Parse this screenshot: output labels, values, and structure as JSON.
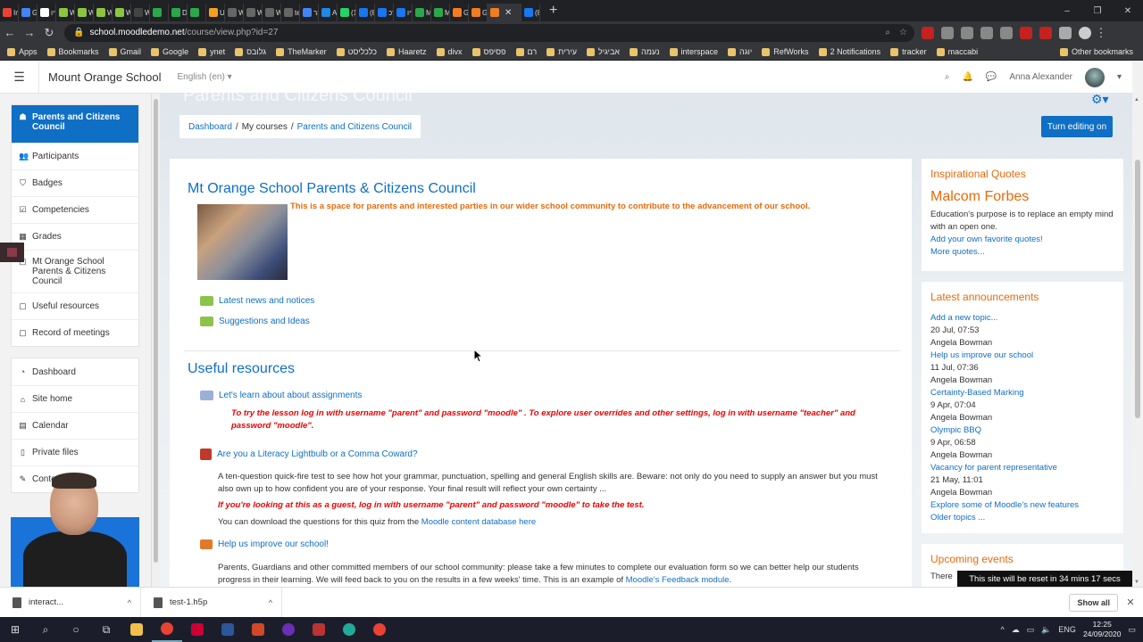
{
  "browser": {
    "tabs": [
      {
        "label": "Inb",
        "color": "#ea4335"
      },
      {
        "label": "Go",
        "color": "#4285f4"
      },
      {
        "label": "דיו",
        "color": "#ffffff"
      },
      {
        "label": "Wh",
        "color": "#8cc63f"
      },
      {
        "label": "Wh",
        "color": "#8cc63f"
      },
      {
        "label": "Wh",
        "color": "#8cc63f"
      },
      {
        "label": "Wh",
        "color": "#8cc63f"
      },
      {
        "label": "We",
        "color": "#444444"
      },
      {
        "label": "",
        "color": "#2aa84a"
      },
      {
        "label": "De",
        "color": "#2aa84a"
      },
      {
        "label": "",
        "color": "#2aa84a"
      },
      {
        "label": "Ult",
        "color": "#f4a020"
      },
      {
        "label": "Wh",
        "color": "#666666"
      },
      {
        "label": "Wh",
        "color": "#666666"
      },
      {
        "label": "Wh",
        "color": "#666666"
      },
      {
        "label": "tes",
        "color": "#666666"
      },
      {
        "label": "קר",
        "color": "#4285f4"
      },
      {
        "label": "All",
        "color": "#1e88e5"
      },
      {
        "label": "(1",
        "color": "#25d366"
      },
      {
        "label": "(8",
        "color": "#1877f2"
      },
      {
        "label": "רכ",
        "color": "#1877f2"
      },
      {
        "label": "דיו",
        "color": "#1877f2"
      },
      {
        "label": "Mc",
        "color": "#2aa84a"
      },
      {
        "label": "Mc",
        "color": "#2aa84a"
      },
      {
        "label": "Ge",
        "color": "#f47c20"
      },
      {
        "label": "Ge",
        "color": "#f47c20"
      },
      {
        "label": "",
        "color": "#f47c20"
      },
      {
        "label": "(8",
        "color": "#1877f2"
      }
    ],
    "url_domain": "school.moodledemo.net",
    "url_path": "/course/view.php?id=27",
    "bookmarks": [
      "Apps",
      "Bookmarks",
      "Gmail",
      "Google",
      "ynet",
      "גלובס",
      "TheMarker",
      "כלכליסט",
      "Haaretz",
      "divx",
      "פסיפס",
      "רם",
      "עירית",
      "אביגיל",
      "נעמה",
      "interspace",
      "יוגה",
      "RefWorks",
      "2 Notifications",
      "tracker",
      "maccabi",
      "Other bookmarks"
    ]
  },
  "moodle": {
    "site_name": "Mount Orange School",
    "language": "English (en)",
    "user_name": "Anna Alexander",
    "course_title": "Parents and Citizens Council",
    "breadcrumb": {
      "dashboard": "Dashboard",
      "sep1": "/",
      "mycourses": "My courses",
      "sep2": "/",
      "course": "Parents and Citizens Council"
    },
    "edit_button": "Turn editing on"
  },
  "drawer": {
    "course_group": [
      {
        "label": "Parents and Citizens Council",
        "icon": "graduation-cap-icon",
        "active": true
      },
      {
        "label": "Participants",
        "icon": "users-icon"
      },
      {
        "label": "Badges",
        "icon": "shield-icon"
      },
      {
        "label": "Competencies",
        "icon": "check-square-icon"
      },
      {
        "label": "Grades",
        "icon": "grades-icon"
      },
      {
        "label": "Mt Orange School Parents & Citizens Council",
        "icon": "folder-icon"
      },
      {
        "label": "Useful resources",
        "icon": "folder-icon"
      },
      {
        "label": "Record of meetings",
        "icon": "folder-icon"
      }
    ],
    "site_group": [
      {
        "label": "Dashboard",
        "icon": "dashboard-icon"
      },
      {
        "label": "Site home",
        "icon": "home-icon"
      },
      {
        "label": "Calendar",
        "icon": "calendar-icon"
      },
      {
        "label": "Private files",
        "icon": "file-icon"
      },
      {
        "label": "Content bank",
        "icon": "paint-brush-icon"
      }
    ]
  },
  "main": {
    "section1_title": "Mt Orange School Parents & Citizens Council",
    "section1_summary": "This is a space for parents and interested parties in our wider school community to contribute to the advancement of our school.",
    "activities1": [
      "Latest news and notices",
      "Suggestions and Ideas"
    ],
    "section2_title": "Useful resources",
    "assign_link": "Let's learn about about assignments",
    "assign_note": "To try the lesson log in with username \"parent\" and password \"moodle\" . To explore user overrides and other settings, log in with username \"teacher\" and password \"moodle\".",
    "quiz_link": "Are you a Literacy Lightbulb or a Comma Coward?",
    "quiz_desc": "A ten-question quick-fire test to see how hot your grammar, punctuation, spelling and general English skills are. Beware: not only do you need to supply an answer but you must also own up to how confident you are of your response. Your final result will reflect your own certainty ...",
    "quiz_guest": "If you're looking at this as a guest, log in with username \"parent\" and password \"moodle\" to take the test.",
    "quiz_download_pre": "You can download the questions for this quiz from the ",
    "quiz_download_link": "Moodle content database here",
    "feedback_link": "Help us improve our school!",
    "feedback_desc_pre": "Parents, Guardians and other committed members of our school community: please take a few minutes to complete our evaluation form so we can better help our students progress in their learning. We will feed back to you on the results in a few weeks' time. This is an example of ",
    "feedback_desc_link": "Moodle's Feedback module",
    "feedback_desc_post": "."
  },
  "blocks": {
    "quotes": {
      "title": "Inspirational Quotes",
      "author": "Malcom Forbes",
      "quote": "Education's purpose is to replace an empty mind with an open one.",
      "add_link": "Add your own favorite quotes!",
      "more_link": "More quotes..."
    },
    "announcements": {
      "title": "Latest announcements",
      "add_link": "Add a new topic...",
      "items": [
        {
          "date": "20 Jul, 07:53",
          "author": "Angela Bowman",
          "title": "Help us improve our school"
        },
        {
          "date": "11 Jul, 07:36",
          "author": "Angela Bowman",
          "title": "Certainty-Based Marking"
        },
        {
          "date": "9 Apr, 07:04",
          "author": "Angela Bowman",
          "title": "Olympic BBQ"
        },
        {
          "date": "9 Apr, 06:58",
          "author": "Angela Bowman",
          "title": "Vacancy for parent representative"
        },
        {
          "date": "21 May, 11:01",
          "author": "Angela Bowman",
          "title": "Explore some of Moodle's new features"
        }
      ],
      "older_link": "Older topics ..."
    },
    "events": {
      "title": "Upcoming events",
      "first_word": "There"
    }
  },
  "reset_notice": "This site will be reset in 34 mins 17 secs",
  "downloads": {
    "items": [
      "interact...",
      "test-1.h5p"
    ],
    "show_all": "Show all"
  },
  "taskbar": {
    "lang": "ENG",
    "time": "12:25",
    "date": "24/09/2020"
  }
}
